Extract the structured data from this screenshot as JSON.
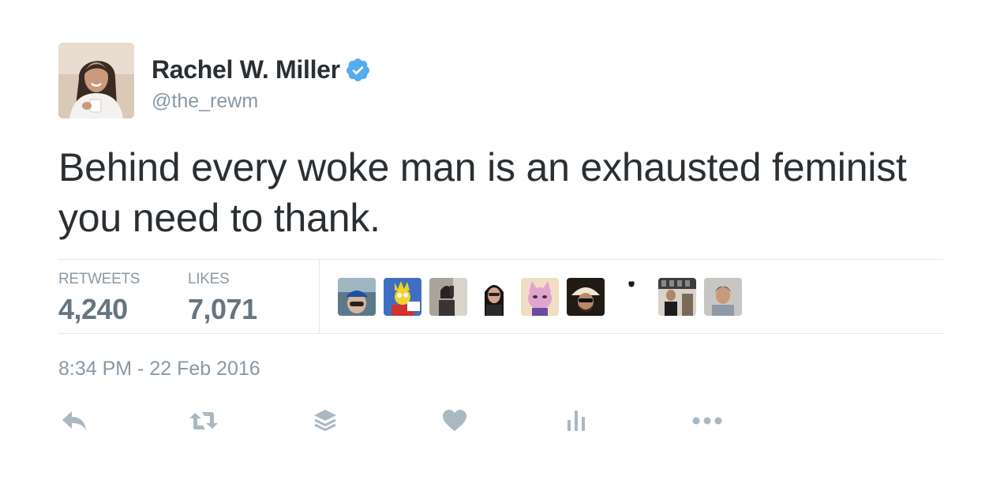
{
  "user": {
    "name": "Rachel W. Miller",
    "handle": "@the_rewm",
    "verified": true
  },
  "tweet": {
    "text_line1": "Behind every woke man is an exhausted feminist",
    "text_line2": "you need to thank."
  },
  "stats": {
    "retweets_label": "RETWEETS",
    "retweets_value": "4,240",
    "likes_label": "LIKES",
    "likes_value": "7,071"
  },
  "timestamp": "8:34 PM - 22 Feb 2016",
  "actions": [
    {
      "icon": "reply-icon"
    },
    {
      "icon": "retweet-icon"
    },
    {
      "icon": "buffer-icon"
    },
    {
      "icon": "like-icon"
    },
    {
      "icon": "analytics-icon"
    },
    {
      "icon": "more-icon"
    }
  ],
  "colors": {
    "text": "#292f33",
    "muted": "#8899a6",
    "stat_value": "#66757f",
    "verified": "#55acee",
    "action_icon": "#aab8c2",
    "divider": "#e1e8ed"
  }
}
